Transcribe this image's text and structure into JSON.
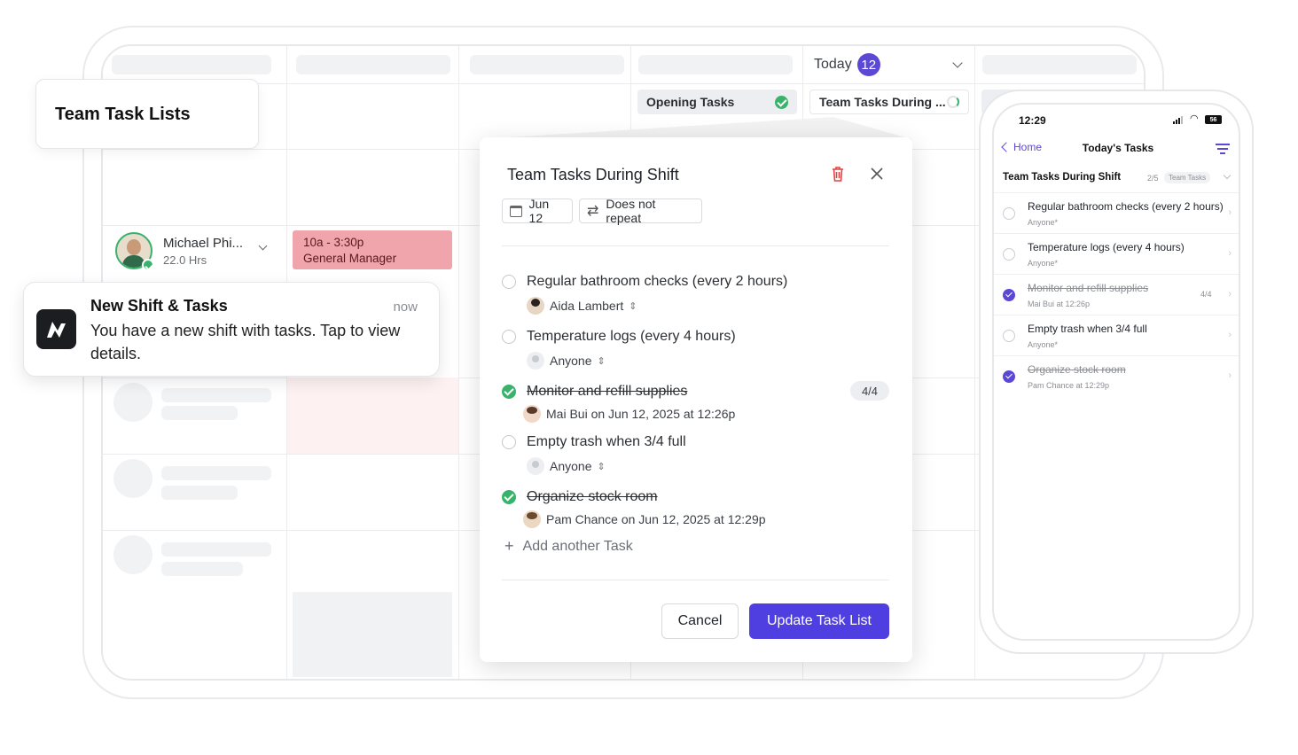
{
  "team_card": {
    "title": "Team Task Lists"
  },
  "calendar": {
    "today_label": "Today",
    "today_date": "12",
    "chips": {
      "opening": "Opening Tasks",
      "during": "Team Tasks During ..."
    },
    "employee": {
      "name": "Michael Phi...",
      "hours": "22.0 Hrs"
    },
    "shift": {
      "time": "10a - 3:30p",
      "role": "General Manager"
    }
  },
  "notification": {
    "title": "New Shift & Tasks",
    "time": "now",
    "body": "You have a new shift with tasks. Tap to view details."
  },
  "modal": {
    "title": "Team Tasks During Shift",
    "date": "Jun 12",
    "repeat": "Does not repeat",
    "tasks": [
      {
        "title": "Regular bathroom checks (every 2 hours)",
        "assignee": "Aida Lambert",
        "done": false
      },
      {
        "title": "Temperature logs (every 4 hours)",
        "assignee": "Anyone",
        "done": false
      },
      {
        "title": "Monitor and refill supplies",
        "assignee": "Mai Bui on Jun 12, 2025 at 12:26p",
        "done": true,
        "count": "4/4"
      },
      {
        "title": "Empty trash when 3/4 full",
        "assignee": "Anyone",
        "done": false
      },
      {
        "title": "Organize stock room",
        "assignee": "Pam Chance on Jun 12, 2025 at 12:29p",
        "done": true
      }
    ],
    "add_label": "Add another Task",
    "cancel_label": "Cancel",
    "update_label": "Update Task List"
  },
  "phone": {
    "time": "12:29",
    "battery": "56",
    "back_label": "Home",
    "title": "Today's Tasks",
    "list_title": "Team Tasks During Shift",
    "list_count": "2/5",
    "list_tag": "Team Tasks",
    "tasks": [
      {
        "title": "Regular bathroom checks (every 2 hours)",
        "sub": "Anyone*",
        "done": false
      },
      {
        "title": "Temperature logs (every 4 hours)",
        "sub": "Anyone*",
        "done": false
      },
      {
        "title": "Monitor and refill supplies",
        "sub": "Mai Bui at 12:26p",
        "done": true,
        "count": "4/4"
      },
      {
        "title": "Empty trash when 3/4 full",
        "sub": "Anyone*",
        "done": false
      },
      {
        "title": "Organize stock room",
        "sub": "Pam Chance at 12:29p",
        "done": true
      }
    ]
  },
  "colors": {
    "accent": "#5b49d6",
    "success": "#38b36b",
    "shift_bg": "#f0a5ad",
    "delete": "#e04444"
  }
}
